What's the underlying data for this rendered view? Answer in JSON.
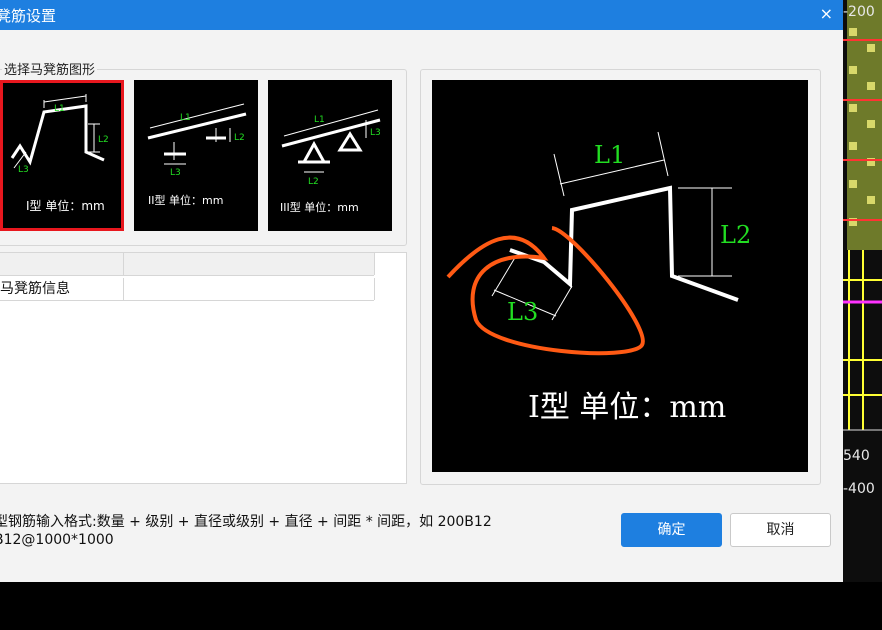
{
  "window": {
    "title": "凳筋设置",
    "close_glyph": "×"
  },
  "shape_group": {
    "title": "选择马凳筋图形"
  },
  "thumbnails": [
    {
      "type_label": "I型 单位：mm",
      "l1": "L1",
      "l2": "L2",
      "l3": "L3",
      "selected": true
    },
    {
      "type_label": "II型 单位：mm",
      "l1": "L1",
      "l2": "L2",
      "l3": "L3",
      "selected": false
    },
    {
      "type_label": "III型 单位：mm",
      "l1": "L1",
      "l2": "L2",
      "l3": "L3",
      "selected": false
    }
  ],
  "info_table": {
    "header": [
      "",
      ""
    ],
    "rows": [
      {
        "name": "马凳筋信息",
        "value": ""
      }
    ]
  },
  "preview": {
    "l1": "L1",
    "l2": "L2",
    "l3": "L3",
    "type_label": "I型 单位：mm"
  },
  "hint": {
    "line1": "型钢筋输入格式:数量 + 级别 + 直径或级别 + 直径 + 间距 * 间距，如 200B12",
    "line2": "B12@1000*1000"
  },
  "buttons": {
    "ok": "确定",
    "cancel": "取消"
  },
  "background_cad": {
    "labels": [
      "-200",
      "540",
      "-400"
    ]
  },
  "colors": {
    "accent": "#1e7fe0",
    "selected_border": "#e8171e",
    "dim_text": "#22dd22",
    "annotation": "#ff5a14"
  }
}
